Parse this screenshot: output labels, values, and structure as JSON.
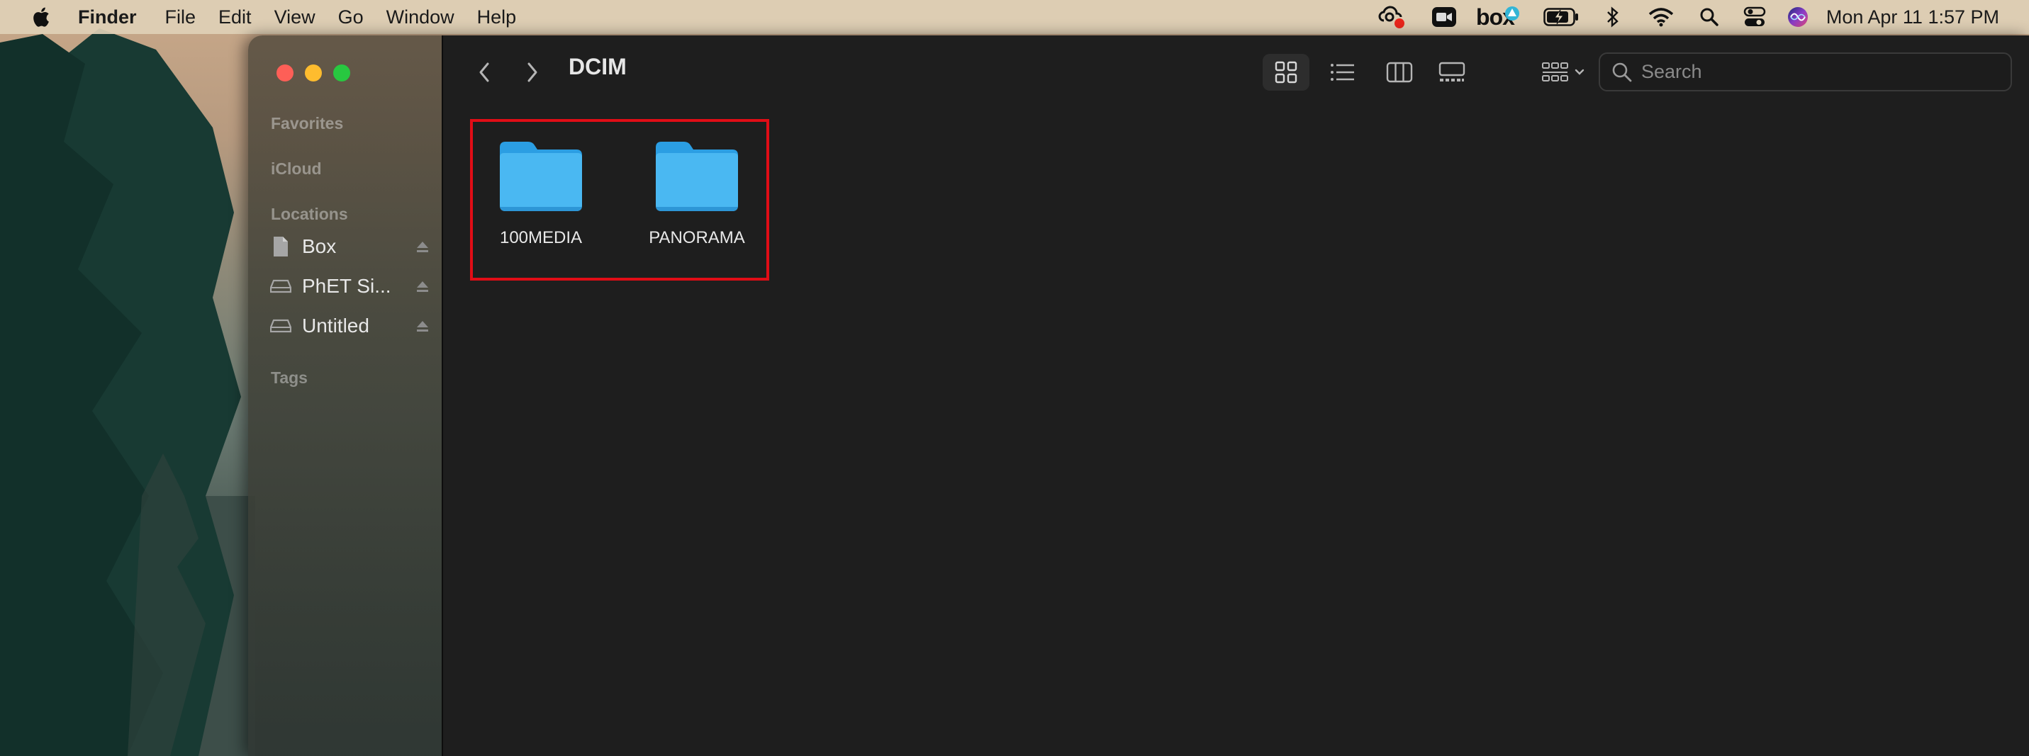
{
  "menubar": {
    "app_name": "Finder",
    "menus": [
      "File",
      "Edit",
      "View",
      "Go",
      "Window",
      "Help"
    ],
    "clock": "Mon Apr 11  1:57 PM",
    "status_icons": [
      "creative-cloud-icon",
      "video-icon",
      "box-sync-icon",
      "battery-charging-icon",
      "bluetooth-icon",
      "wifi-icon",
      "spotlight-search-icon",
      "control-center-icon",
      "siri-icon"
    ],
    "box_label": "box"
  },
  "window": {
    "title": "DCIM",
    "sidebar": {
      "favorites_header": "Favorites",
      "icloud_header": "iCloud",
      "locations_header": "Locations",
      "locations": [
        {
          "label": "Box",
          "icon": "document-icon"
        },
        {
          "label": "PhET Si...",
          "icon": "drive-icon"
        },
        {
          "label": "Untitled",
          "icon": "drive-icon"
        }
      ],
      "tags_header": "Tags"
    },
    "toolbar": {
      "selected_view": "icon",
      "search_placeholder": "Search"
    },
    "items": [
      {
        "name": "100MEDIA",
        "type": "folder"
      },
      {
        "name": "PANORAMA",
        "type": "folder"
      }
    ],
    "highlight_color": "#e00d16",
    "folder_color": "#4ab8f2"
  }
}
